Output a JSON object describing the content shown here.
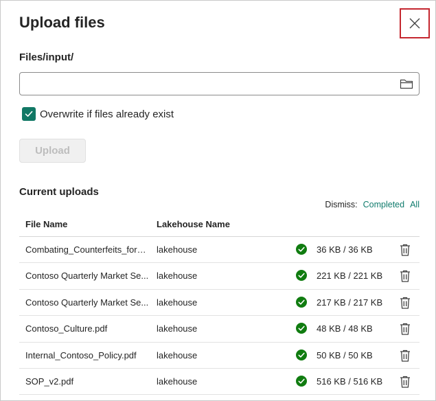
{
  "dialog": {
    "title": "Upload files",
    "path_label": "Files/input/",
    "file_input_value": "",
    "overwrite_label": "Overwrite if files already exist",
    "overwrite_checked": true,
    "upload_button": "Upload",
    "accent_color": "#117865",
    "close_border_color": "#c4262e"
  },
  "uploads": {
    "section_title": "Current uploads",
    "dismiss_label": "Dismiss:",
    "dismiss_completed": "Completed",
    "dismiss_all": "All",
    "columns": [
      "File Name",
      "Lakehouse Name"
    ],
    "rows": [
      {
        "file": "Combating_Counterfeits_for_...",
        "lakehouse": "lakehouse",
        "status": "completed",
        "size": "36 KB / 36 KB"
      },
      {
        "file": "Contoso Quarterly Market Se...",
        "lakehouse": "lakehouse",
        "status": "completed",
        "size": "221 KB / 221 KB"
      },
      {
        "file": "Contoso Quarterly Market Se...",
        "lakehouse": "lakehouse",
        "status": "completed",
        "size": "217 KB / 217 KB"
      },
      {
        "file": "Contoso_Culture.pdf",
        "lakehouse": "lakehouse",
        "status": "completed",
        "size": "48 KB / 48 KB"
      },
      {
        "file": "Internal_Contoso_Policy.pdf",
        "lakehouse": "lakehouse",
        "status": "completed",
        "size": "50 KB / 50 KB"
      },
      {
        "file": "SOP_v2.pdf",
        "lakehouse": "lakehouse",
        "status": "completed",
        "size": "516 KB / 516 KB"
      }
    ]
  },
  "icons": {
    "close": "close-icon",
    "folder": "folder-icon",
    "checkmark": "checkmark-icon",
    "status": "success-check-icon",
    "delete": "trash-icon"
  }
}
